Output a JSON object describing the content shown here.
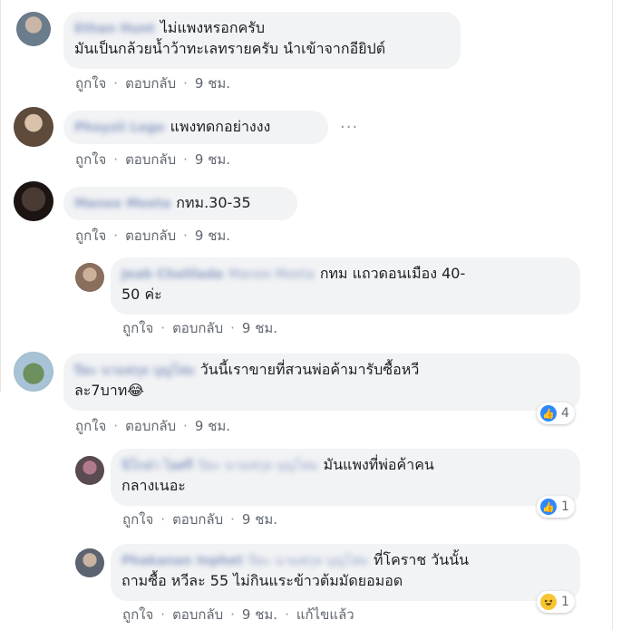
{
  "actions": {
    "like": "ถูกใจ",
    "reply": "ตอบกลับ",
    "separator": "·",
    "edited": "แก้ไขแล้ว"
  },
  "comments": [
    {
      "name": "Ethan Hunt",
      "text_lines": [
        "ไม่แพงหรอกครับ",
        "มันเป็นกล้วยน้ำว้าทะเลทรายครับ นำเข้าจากอียิปต์"
      ],
      "time": "9 ชม."
    },
    {
      "name": "Phoyzii Lego",
      "text_lines": [
        "แพงทดกอย่างงง"
      ],
      "time": "9 ชม.",
      "more": "···"
    },
    {
      "name": "Manee Meeta",
      "text_lines": [
        "กทม.30-35"
      ],
      "time": "9 ชม."
    },
    {
      "name": "Jeab Cholilada",
      "mention": "Manee Meeta",
      "text_lines": [
        "กทม แถวดอนเมือง 40-",
        "50 ค่ะ"
      ],
      "time": "9 ชม."
    },
    {
      "name": "ปิยะ นามสกุล บุญโสม",
      "text_lines": [
        "วันนี้เราขายที่สวนพ่อค้ามารับซื้อหวี",
        "ละ7บาท😂"
      ],
      "time": "9 ชม.",
      "reaction": {
        "type": "like",
        "count": "4"
      }
    },
    {
      "name": "นิโกล่า ไอศรี",
      "mention": "ปิยะ นามสกุล บุญโสม",
      "text_lines": [
        "มันแพงที่พ่อค้าคน",
        "กลางเนอะ"
      ],
      "time": "9 ชม.",
      "reaction": {
        "type": "like",
        "count": "1"
      }
    },
    {
      "name": "Phakanan Inphet",
      "mention": "ปิยะ นามสกุล บุญโสม",
      "text_lines": [
        "ที่โคราช วันนั้น",
        "ถามซื้อ หวีละ 55 ไม่กินแระข้าวต้มมัดยอมอด"
      ],
      "time": "9 ชม.",
      "edited": true,
      "reaction": {
        "type": "haha",
        "count": "1"
      }
    }
  ],
  "colors": {
    "name": "#385898",
    "bubble": "#f2f3f5",
    "action": "#616770",
    "like": "#2d88ff",
    "haha": "#f7c531"
  }
}
